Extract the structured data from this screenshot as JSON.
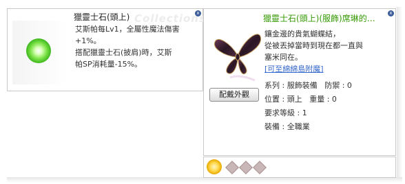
{
  "left_window": {
    "title": "獵靈士石(頭上)",
    "watermark": "Collections",
    "close_label": "x",
    "description": [
      "艾斯帕每Lv1，全屬性魔法傷害",
      "+1%。",
      "搭配獵靈士石(披肩)時，艾斯",
      "帕SP消耗量-15%。"
    ]
  },
  "right_window": {
    "title": "獵靈士石(頭上)(服飾)席琳的…",
    "close_label": "x",
    "description": [
      "鑲金邊的貴氣蝴蝶結，",
      "從被丟掉當時到現在都一直與",
      "塞米同在。"
    ],
    "link": "[可至綿綿島附魔]",
    "stats": {
      "type_label": "系列",
      "type_value": "服飾裝備",
      "defense_label": "防禦",
      "defense_value": "0",
      "location_label": "位置",
      "location_value": "頭上",
      "weight_label": "重量",
      "weight_value": "0",
      "level_label": "要求等級",
      "level_value": "1",
      "equip_label": "裝備",
      "equip_value": "全職業"
    },
    "button_label": "配戴外觀"
  },
  "slots": {
    "count": 3
  },
  "colors": {
    "title_green": "#339900",
    "link_blue": "#3366cc"
  }
}
